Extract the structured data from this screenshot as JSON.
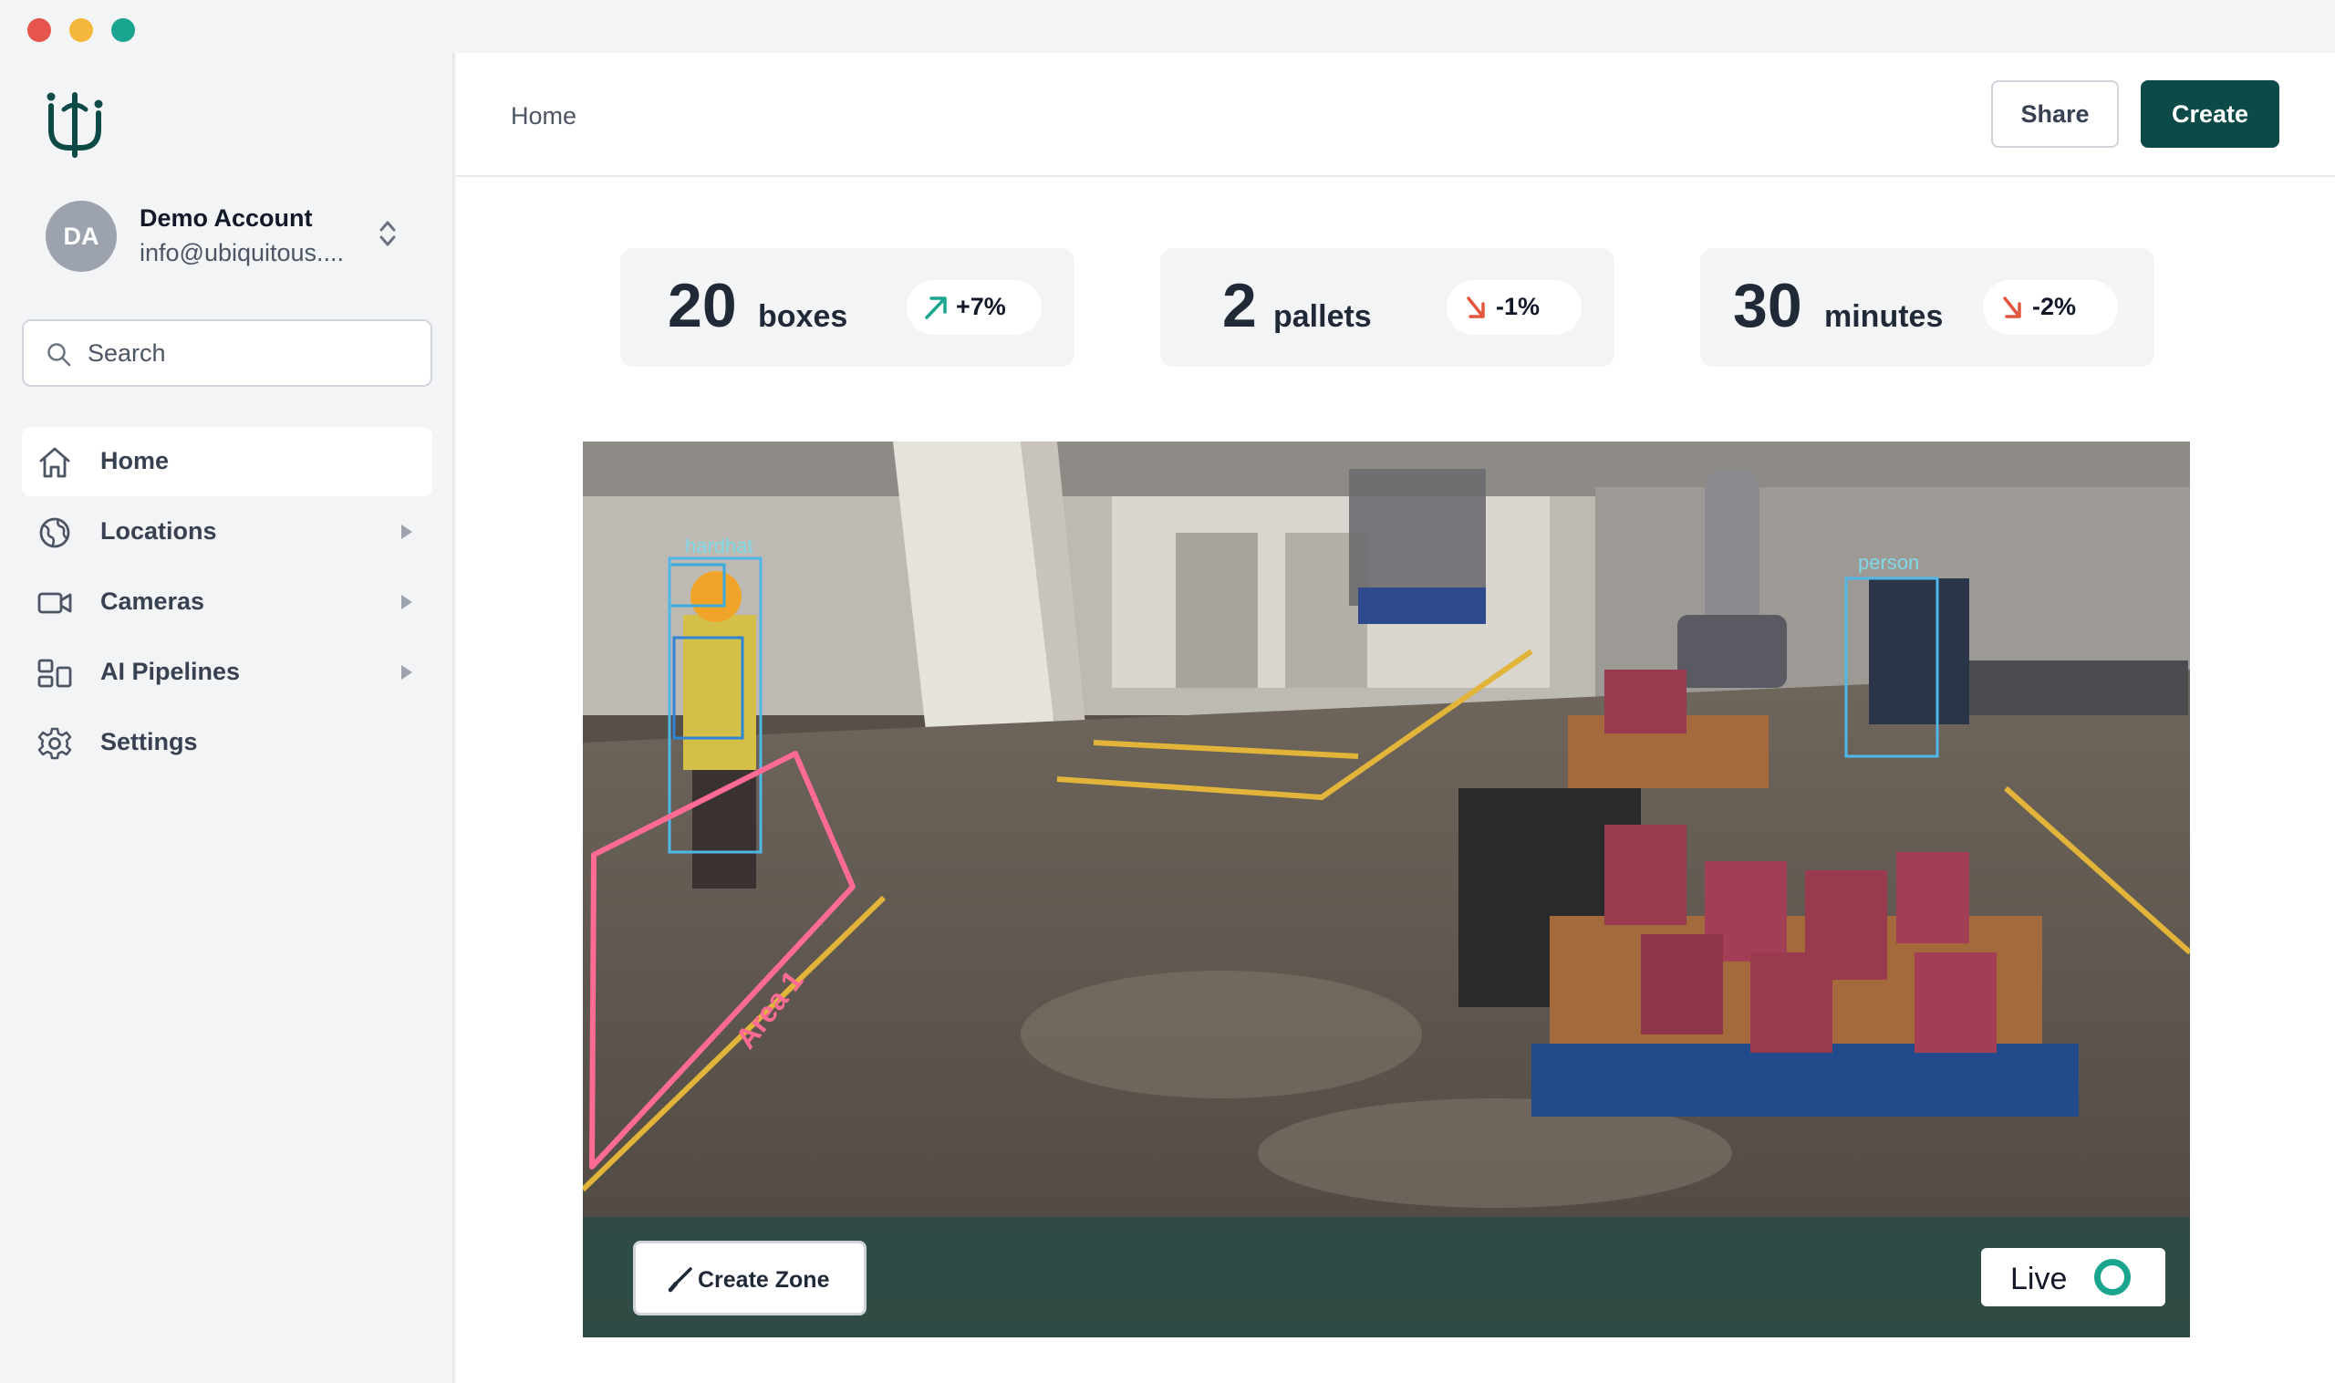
{
  "window": {
    "controls": {
      "close_color": "#e5554b",
      "minimize_color": "#f4b73b",
      "maximize_color": "#1aa58e"
    }
  },
  "sidebar": {
    "logo_icon": "ubiquitous-logo-icon",
    "account": {
      "initials": "DA",
      "name": "Demo Account",
      "email": "info@ubiquitous...."
    },
    "search": {
      "placeholder": "Search"
    },
    "items": [
      {
        "label": "Home",
        "icon": "home-icon",
        "active": true,
        "has_children": false
      },
      {
        "label": "Locations",
        "icon": "globe-icon",
        "active": false,
        "has_children": true
      },
      {
        "label": "Cameras",
        "icon": "video-camera-icon",
        "active": false,
        "has_children": true
      },
      {
        "label": "AI Pipelines",
        "icon": "pipelines-icon",
        "active": false,
        "has_children": true
      },
      {
        "label": "Settings",
        "icon": "gear-icon",
        "active": false,
        "has_children": false
      }
    ]
  },
  "header": {
    "breadcrumb": "Home",
    "share_label": "Share",
    "create_label": "Create"
  },
  "stats": [
    {
      "value": "20",
      "unit": "boxes",
      "delta": "+7%",
      "trend": "up",
      "trend_color": "#1aa58e"
    },
    {
      "value": "2",
      "unit": "pallets",
      "delta": "-1%",
      "trend": "down",
      "trend_color": "#e2553f"
    },
    {
      "value": "30",
      "unit": "minutes",
      "delta": "-2%",
      "trend": "down",
      "trend_color": "#e2553f"
    }
  ],
  "video": {
    "zone_label": "Area 1",
    "zone_color": "#ff6b93",
    "detections": [
      "hardhat",
      "person"
    ],
    "create_zone_label": "Create Zone",
    "live_label": "Live",
    "live_color": "#1aa58e"
  },
  "colors": {
    "accent": "#0b4a47"
  }
}
